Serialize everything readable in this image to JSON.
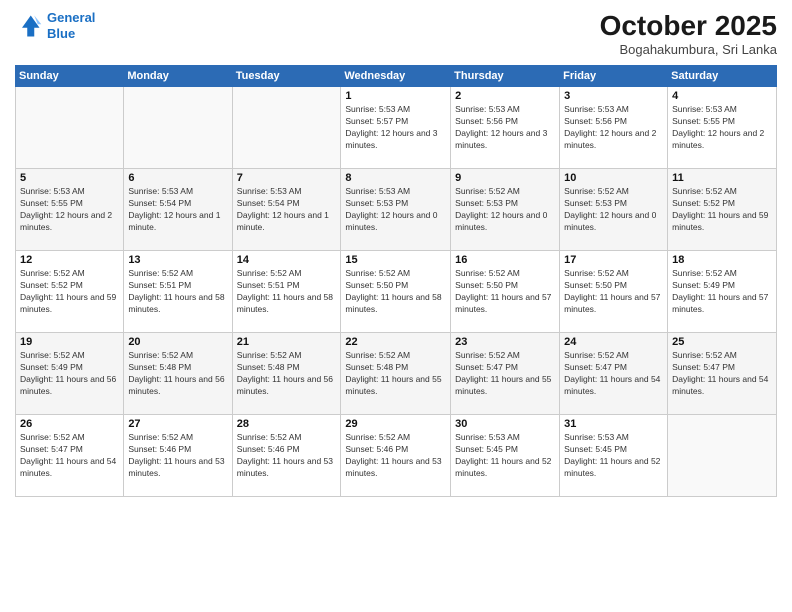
{
  "header": {
    "logo_line1": "General",
    "logo_line2": "Blue",
    "month": "October 2025",
    "location": "Bogahakumbura, Sri Lanka"
  },
  "weekdays": [
    "Sunday",
    "Monday",
    "Tuesday",
    "Wednesday",
    "Thursday",
    "Friday",
    "Saturday"
  ],
  "weeks": [
    [
      {
        "day": "",
        "sunrise": "",
        "sunset": "",
        "daylight": ""
      },
      {
        "day": "",
        "sunrise": "",
        "sunset": "",
        "daylight": ""
      },
      {
        "day": "",
        "sunrise": "",
        "sunset": "",
        "daylight": ""
      },
      {
        "day": "1",
        "sunrise": "Sunrise: 5:53 AM",
        "sunset": "Sunset: 5:57 PM",
        "daylight": "Daylight: 12 hours and 3 minutes."
      },
      {
        "day": "2",
        "sunrise": "Sunrise: 5:53 AM",
        "sunset": "Sunset: 5:56 PM",
        "daylight": "Daylight: 12 hours and 3 minutes."
      },
      {
        "day": "3",
        "sunrise": "Sunrise: 5:53 AM",
        "sunset": "Sunset: 5:56 PM",
        "daylight": "Daylight: 12 hours and 2 minutes."
      },
      {
        "day": "4",
        "sunrise": "Sunrise: 5:53 AM",
        "sunset": "Sunset: 5:55 PM",
        "daylight": "Daylight: 12 hours and 2 minutes."
      }
    ],
    [
      {
        "day": "5",
        "sunrise": "Sunrise: 5:53 AM",
        "sunset": "Sunset: 5:55 PM",
        "daylight": "Daylight: 12 hours and 2 minutes."
      },
      {
        "day": "6",
        "sunrise": "Sunrise: 5:53 AM",
        "sunset": "Sunset: 5:54 PM",
        "daylight": "Daylight: 12 hours and 1 minute."
      },
      {
        "day": "7",
        "sunrise": "Sunrise: 5:53 AM",
        "sunset": "Sunset: 5:54 PM",
        "daylight": "Daylight: 12 hours and 1 minute."
      },
      {
        "day": "8",
        "sunrise": "Sunrise: 5:53 AM",
        "sunset": "Sunset: 5:53 PM",
        "daylight": "Daylight: 12 hours and 0 minutes."
      },
      {
        "day": "9",
        "sunrise": "Sunrise: 5:52 AM",
        "sunset": "Sunset: 5:53 PM",
        "daylight": "Daylight: 12 hours and 0 minutes."
      },
      {
        "day": "10",
        "sunrise": "Sunrise: 5:52 AM",
        "sunset": "Sunset: 5:53 PM",
        "daylight": "Daylight: 12 hours and 0 minutes."
      },
      {
        "day": "11",
        "sunrise": "Sunrise: 5:52 AM",
        "sunset": "Sunset: 5:52 PM",
        "daylight": "Daylight: 11 hours and 59 minutes."
      }
    ],
    [
      {
        "day": "12",
        "sunrise": "Sunrise: 5:52 AM",
        "sunset": "Sunset: 5:52 PM",
        "daylight": "Daylight: 11 hours and 59 minutes."
      },
      {
        "day": "13",
        "sunrise": "Sunrise: 5:52 AM",
        "sunset": "Sunset: 5:51 PM",
        "daylight": "Daylight: 11 hours and 58 minutes."
      },
      {
        "day": "14",
        "sunrise": "Sunrise: 5:52 AM",
        "sunset": "Sunset: 5:51 PM",
        "daylight": "Daylight: 11 hours and 58 minutes."
      },
      {
        "day": "15",
        "sunrise": "Sunrise: 5:52 AM",
        "sunset": "Sunset: 5:50 PM",
        "daylight": "Daylight: 11 hours and 58 minutes."
      },
      {
        "day": "16",
        "sunrise": "Sunrise: 5:52 AM",
        "sunset": "Sunset: 5:50 PM",
        "daylight": "Daylight: 11 hours and 57 minutes."
      },
      {
        "day": "17",
        "sunrise": "Sunrise: 5:52 AM",
        "sunset": "Sunset: 5:50 PM",
        "daylight": "Daylight: 11 hours and 57 minutes."
      },
      {
        "day": "18",
        "sunrise": "Sunrise: 5:52 AM",
        "sunset": "Sunset: 5:49 PM",
        "daylight": "Daylight: 11 hours and 57 minutes."
      }
    ],
    [
      {
        "day": "19",
        "sunrise": "Sunrise: 5:52 AM",
        "sunset": "Sunset: 5:49 PM",
        "daylight": "Daylight: 11 hours and 56 minutes."
      },
      {
        "day": "20",
        "sunrise": "Sunrise: 5:52 AM",
        "sunset": "Sunset: 5:48 PM",
        "daylight": "Daylight: 11 hours and 56 minutes."
      },
      {
        "day": "21",
        "sunrise": "Sunrise: 5:52 AM",
        "sunset": "Sunset: 5:48 PM",
        "daylight": "Daylight: 11 hours and 56 minutes."
      },
      {
        "day": "22",
        "sunrise": "Sunrise: 5:52 AM",
        "sunset": "Sunset: 5:48 PM",
        "daylight": "Daylight: 11 hours and 55 minutes."
      },
      {
        "day": "23",
        "sunrise": "Sunrise: 5:52 AM",
        "sunset": "Sunset: 5:47 PM",
        "daylight": "Daylight: 11 hours and 55 minutes."
      },
      {
        "day": "24",
        "sunrise": "Sunrise: 5:52 AM",
        "sunset": "Sunset: 5:47 PM",
        "daylight": "Daylight: 11 hours and 54 minutes."
      },
      {
        "day": "25",
        "sunrise": "Sunrise: 5:52 AM",
        "sunset": "Sunset: 5:47 PM",
        "daylight": "Daylight: 11 hours and 54 minutes."
      }
    ],
    [
      {
        "day": "26",
        "sunrise": "Sunrise: 5:52 AM",
        "sunset": "Sunset: 5:47 PM",
        "daylight": "Daylight: 11 hours and 54 minutes."
      },
      {
        "day": "27",
        "sunrise": "Sunrise: 5:52 AM",
        "sunset": "Sunset: 5:46 PM",
        "daylight": "Daylight: 11 hours and 53 minutes."
      },
      {
        "day": "28",
        "sunrise": "Sunrise: 5:52 AM",
        "sunset": "Sunset: 5:46 PM",
        "daylight": "Daylight: 11 hours and 53 minutes."
      },
      {
        "day": "29",
        "sunrise": "Sunrise: 5:52 AM",
        "sunset": "Sunset: 5:46 PM",
        "daylight": "Daylight: 11 hours and 53 minutes."
      },
      {
        "day": "30",
        "sunrise": "Sunrise: 5:53 AM",
        "sunset": "Sunset: 5:45 PM",
        "daylight": "Daylight: 11 hours and 52 minutes."
      },
      {
        "day": "31",
        "sunrise": "Sunrise: 5:53 AM",
        "sunset": "Sunset: 5:45 PM",
        "daylight": "Daylight: 11 hours and 52 minutes."
      },
      {
        "day": "",
        "sunrise": "",
        "sunset": "",
        "daylight": ""
      }
    ]
  ]
}
